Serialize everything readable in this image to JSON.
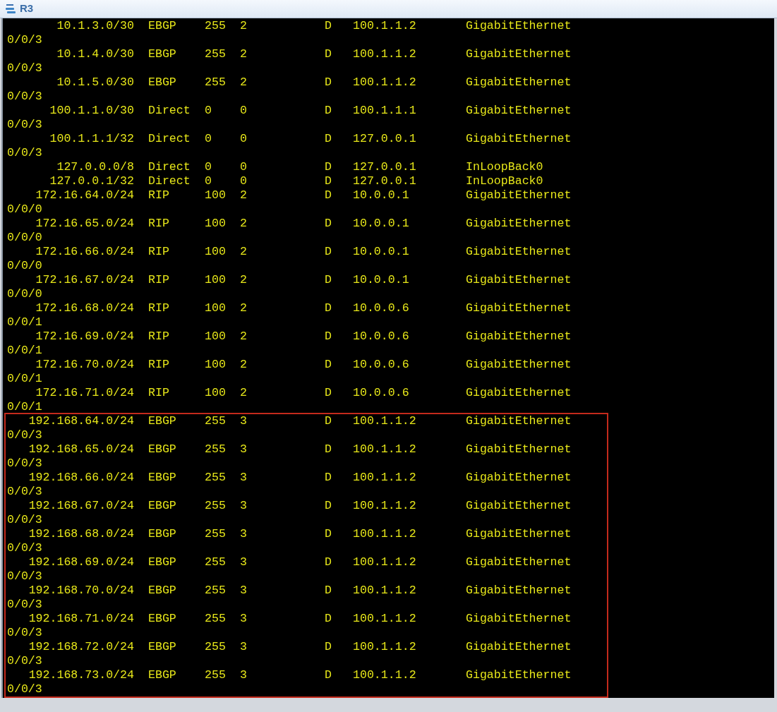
{
  "window": {
    "title": "R3"
  },
  "routes": [
    {
      "destination": "10.1.3.0/30",
      "proto": "EBGP",
      "pre": "255",
      "cost": "2",
      "flags": "D",
      "nexthop": "100.1.1.2",
      "interface": "GigabitEthernet",
      "interface_cont": "0/0/3"
    },
    {
      "destination": "10.1.4.0/30",
      "proto": "EBGP",
      "pre": "255",
      "cost": "2",
      "flags": "D",
      "nexthop": "100.1.1.2",
      "interface": "GigabitEthernet",
      "interface_cont": "0/0/3"
    },
    {
      "destination": "10.1.5.0/30",
      "proto": "EBGP",
      "pre": "255",
      "cost": "2",
      "flags": "D",
      "nexthop": "100.1.1.2",
      "interface": "GigabitEthernet",
      "interface_cont": "0/0/3"
    },
    {
      "destination": "100.1.1.0/30",
      "proto": "Direct",
      "pre": "0",
      "cost": "0",
      "flags": "D",
      "nexthop": "100.1.1.1",
      "interface": "GigabitEthernet",
      "interface_cont": "0/0/3"
    },
    {
      "destination": "100.1.1.1/32",
      "proto": "Direct",
      "pre": "0",
      "cost": "0",
      "flags": "D",
      "nexthop": "127.0.0.1",
      "interface": "GigabitEthernet",
      "interface_cont": "0/0/3"
    },
    {
      "destination": "127.0.0.0/8",
      "proto": "Direct",
      "pre": "0",
      "cost": "0",
      "flags": "D",
      "nexthop": "127.0.0.1",
      "interface": "InLoopBack0"
    },
    {
      "destination": "127.0.0.1/32",
      "proto": "Direct",
      "pre": "0",
      "cost": "0",
      "flags": "D",
      "nexthop": "127.0.0.1",
      "interface": "InLoopBack0"
    },
    {
      "destination": "172.16.64.0/24",
      "proto": "RIP",
      "pre": "100",
      "cost": "2",
      "flags": "D",
      "nexthop": "10.0.0.1",
      "interface": "GigabitEthernet",
      "interface_cont": "0/0/0"
    },
    {
      "destination": "172.16.65.0/24",
      "proto": "RIP",
      "pre": "100",
      "cost": "2",
      "flags": "D",
      "nexthop": "10.0.0.1",
      "interface": "GigabitEthernet",
      "interface_cont": "0/0/0"
    },
    {
      "destination": "172.16.66.0/24",
      "proto": "RIP",
      "pre": "100",
      "cost": "2",
      "flags": "D",
      "nexthop": "10.0.0.1",
      "interface": "GigabitEthernet",
      "interface_cont": "0/0/0"
    },
    {
      "destination": "172.16.67.0/24",
      "proto": "RIP",
      "pre": "100",
      "cost": "2",
      "flags": "D",
      "nexthop": "10.0.0.1",
      "interface": "GigabitEthernet",
      "interface_cont": "0/0/0"
    },
    {
      "destination": "172.16.68.0/24",
      "proto": "RIP",
      "pre": "100",
      "cost": "2",
      "flags": "D",
      "nexthop": "10.0.0.6",
      "interface": "GigabitEthernet",
      "interface_cont": "0/0/1"
    },
    {
      "destination": "172.16.69.0/24",
      "proto": "RIP",
      "pre": "100",
      "cost": "2",
      "flags": "D",
      "nexthop": "10.0.0.6",
      "interface": "GigabitEthernet",
      "interface_cont": "0/0/1"
    },
    {
      "destination": "172.16.70.0/24",
      "proto": "RIP",
      "pre": "100",
      "cost": "2",
      "flags": "D",
      "nexthop": "10.0.0.6",
      "interface": "GigabitEthernet",
      "interface_cont": "0/0/1"
    },
    {
      "destination": "172.16.71.0/24",
      "proto": "RIP",
      "pre": "100",
      "cost": "2",
      "flags": "D",
      "nexthop": "10.0.0.6",
      "interface": "GigabitEthernet",
      "interface_cont": "0/0/1"
    }
  ],
  "highlighted_routes": [
    {
      "destination": "192.168.64.0/24",
      "proto": "EBGP",
      "pre": "255",
      "cost": "3",
      "flags": "D",
      "nexthop": "100.1.1.2",
      "interface": "GigabitEthernet",
      "interface_cont": "0/0/3"
    },
    {
      "destination": "192.168.65.0/24",
      "proto": "EBGP",
      "pre": "255",
      "cost": "3",
      "flags": "D",
      "nexthop": "100.1.1.2",
      "interface": "GigabitEthernet",
      "interface_cont": "0/0/3"
    },
    {
      "destination": "192.168.66.0/24",
      "proto": "EBGP",
      "pre": "255",
      "cost": "3",
      "flags": "D",
      "nexthop": "100.1.1.2",
      "interface": "GigabitEthernet",
      "interface_cont": "0/0/3"
    },
    {
      "destination": "192.168.67.0/24",
      "proto": "EBGP",
      "pre": "255",
      "cost": "3",
      "flags": "D",
      "nexthop": "100.1.1.2",
      "interface": "GigabitEthernet",
      "interface_cont": "0/0/3"
    },
    {
      "destination": "192.168.68.0/24",
      "proto": "EBGP",
      "pre": "255",
      "cost": "3",
      "flags": "D",
      "nexthop": "100.1.1.2",
      "interface": "GigabitEthernet",
      "interface_cont": "0/0/3"
    },
    {
      "destination": "192.168.69.0/24",
      "proto": "EBGP",
      "pre": "255",
      "cost": "3",
      "flags": "D",
      "nexthop": "100.1.1.2",
      "interface": "GigabitEthernet",
      "interface_cont": "0/0/3"
    },
    {
      "destination": "192.168.70.0/24",
      "proto": "EBGP",
      "pre": "255",
      "cost": "3",
      "flags": "D",
      "nexthop": "100.1.1.2",
      "interface": "GigabitEthernet",
      "interface_cont": "0/0/3"
    },
    {
      "destination": "192.168.71.0/24",
      "proto": "EBGP",
      "pre": "255",
      "cost": "3",
      "flags": "D",
      "nexthop": "100.1.1.2",
      "interface": "GigabitEthernet",
      "interface_cont": "0/0/3"
    },
    {
      "destination": "192.168.72.0/24",
      "proto": "EBGP",
      "pre": "255",
      "cost": "3",
      "flags": "D",
      "nexthop": "100.1.1.2",
      "interface": "GigabitEthernet",
      "interface_cont": "0/0/3"
    },
    {
      "destination": "192.168.73.0/24",
      "proto": "EBGP",
      "pre": "255",
      "cost": "3",
      "flags": "D",
      "nexthop": "100.1.1.2",
      "interface": "GigabitEthernet",
      "interface_cont": "0/0/3"
    }
  ]
}
